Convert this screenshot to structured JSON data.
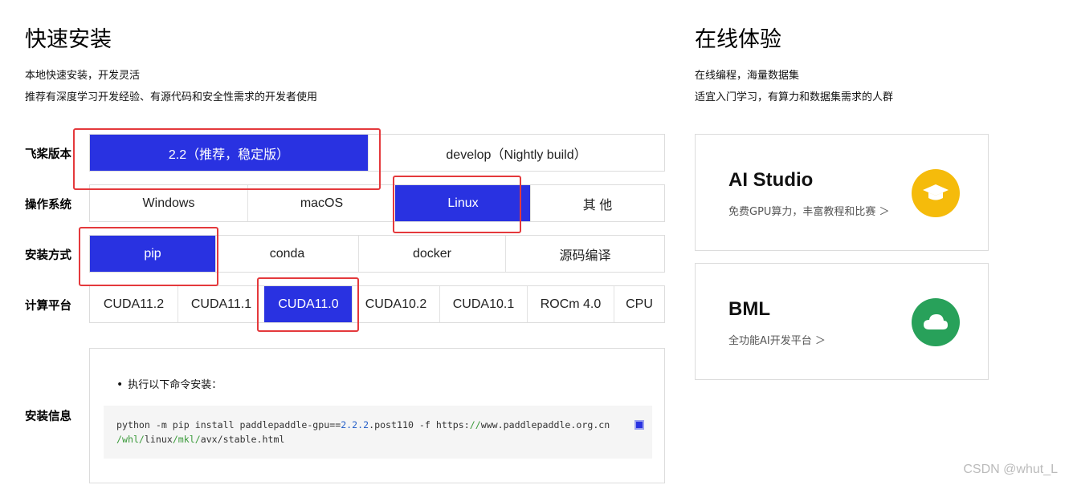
{
  "left": {
    "title": "快速安装",
    "subtitle_1": "本地快速安装，开发灵活",
    "subtitle_2": "推荐有深度学习开发经验、有源代码和安全性需求的开发者使用"
  },
  "right": {
    "title": "在线体验",
    "subtitle_1": "在线编程，海量数据集",
    "subtitle_2": "适宜入门学习，有算力和数据集需求的人群"
  },
  "rows": {
    "version": {
      "label": "飞桨版本",
      "options": [
        "2.2（推荐，稳定版）",
        "develop（Nightly build）"
      ],
      "selected": "2.2（推荐，稳定版）"
    },
    "os": {
      "label": "操作系统",
      "options": [
        "Windows",
        "macOS",
        "Linux",
        "其 他"
      ],
      "selected": "Linux"
    },
    "install": {
      "label": "安装方式",
      "options": [
        "pip",
        "conda",
        "docker",
        "源码编译"
      ],
      "selected": "pip"
    },
    "compute": {
      "label": "计算平台",
      "options": [
        "CUDA11.2",
        "CUDA11.1",
        "CUDA11.0",
        "CUDA10.2",
        "CUDA10.1",
        "ROCm 4.0",
        "CPU"
      ],
      "selected": "CUDA11.0"
    },
    "info": {
      "label": "安装信息"
    }
  },
  "install_info": {
    "bullet": "执行以下命令安装：",
    "code_line1_a": "python -m pip install paddlepaddle-gpu==",
    "code_line1_ver": "2.2.2",
    "code_line1_b": ".post110 -f https:",
    "code_line1_slashes": "//",
    "code_line1_c": "www.paddlepaddle.org.cn",
    "code_line2_a": "/whl/",
    "code_line2_b": "linux",
    "code_line2_c": "/mkl/",
    "code_line2_d": "avx/stable.html"
  },
  "cards": {
    "ai_studio": {
      "title": "AI Studio",
      "desc": "免费GPU算力，丰富教程和比赛 ＞",
      "icon": "graduation-cap-icon",
      "icon_color": "#f5bb0b"
    },
    "bml": {
      "title": "BML",
      "desc": "全功能AI开发平台 ＞",
      "icon": "cloud-icon",
      "icon_color": "#28a15a"
    }
  },
  "colors": {
    "accent": "#2932e1",
    "highlight": "#e4393c"
  },
  "watermark": "CSDN @whut_L"
}
